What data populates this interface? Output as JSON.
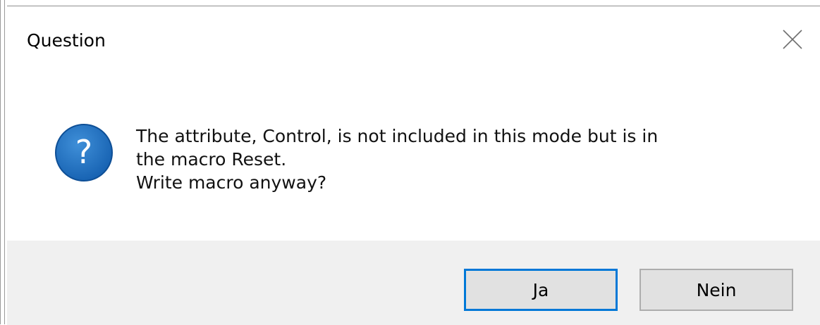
{
  "dialog": {
    "title": "Question",
    "icon": "question-icon",
    "close_icon": "close-icon",
    "message_lines": [
      "The attribute, Control, is not included in this mode but is in",
      "the macro Reset.",
      "Write macro anyway?"
    ]
  },
  "buttons": {
    "yes_label": "Ja",
    "no_label": "Nein"
  },
  "colors": {
    "accent": "#0078d7",
    "footer_bg": "#f0f0f0",
    "button_bg": "#e1e1e1",
    "icon_blue": "#1e6fc0"
  }
}
